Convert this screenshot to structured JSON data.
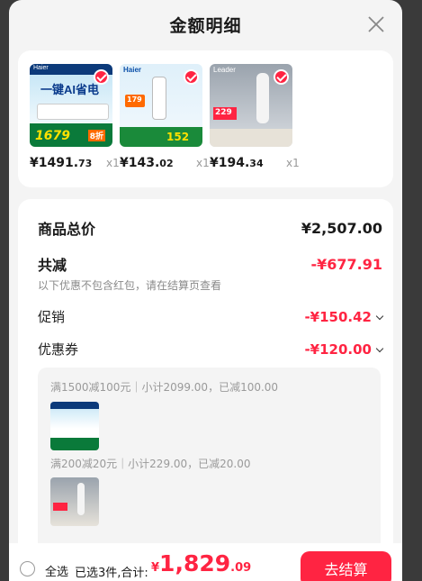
{
  "header": {
    "title": "金额明细"
  },
  "products": [
    {
      "price_int": "¥1491.",
      "price_dec": "73",
      "qty": "x1",
      "image_text": [
        "一键AI省电",
        "1679",
        "8折"
      ],
      "brand": "Haier"
    },
    {
      "price_int": "¥143.",
      "price_dec": "02",
      "qty": "x1",
      "image_text": [
        "179",
        "152"
      ],
      "brand": "Haier"
    },
    {
      "price_int": "¥194.",
      "price_dec": "34",
      "qty": "x1",
      "image_text": [
        "229"
      ],
      "brand": "Leader"
    }
  ],
  "summary": {
    "total_label": "商品总价",
    "total_value": "¥2,507.00",
    "discount_label": "共减",
    "discount_value": "-¥677.91",
    "note": "以下优惠不包含红包，请在结算页查看",
    "promo_label": "促销",
    "promo_value": "-¥150.42",
    "coupon_label": "优惠券",
    "coupon_value": "-¥120.00"
  },
  "coupons": [
    {
      "text": "满1500减100元｜小计2099.00，已减100.00"
    },
    {
      "text": "满200减20元｜小计229.00，已减20.00"
    }
  ],
  "footer": {
    "select_all": "全选",
    "summary_text": "已选3件,合计:",
    "currency": "¥",
    "total_int": "1,829",
    "total_dec": ".09",
    "checkout": "去结算"
  },
  "colors": {
    "accent": "#ff2442",
    "background": "#f4f4f4"
  }
}
